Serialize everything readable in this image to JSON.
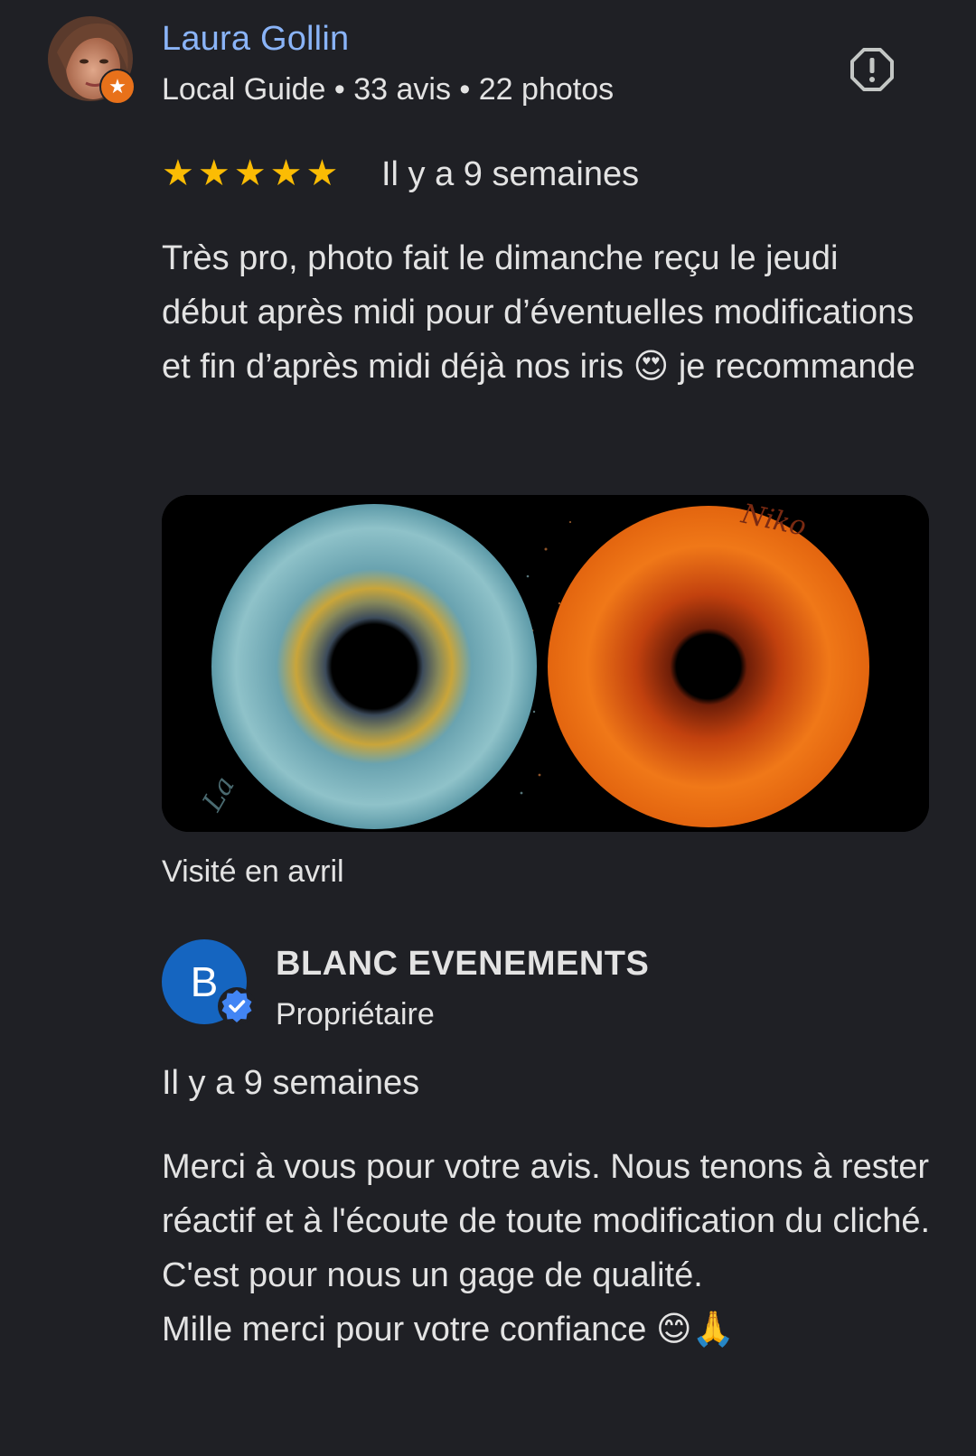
{
  "review": {
    "author": {
      "name": "Laura Gollin",
      "meta": "Local Guide • 33 avis • 22 photos",
      "avatar_icon": "user-photo",
      "badge_icon": "local-guide-star-icon"
    },
    "report_icon": "report-icon",
    "rating": 5,
    "stars": [
      "★",
      "★",
      "★",
      "★",
      "★"
    ],
    "date": "Il y a 9 semaines",
    "text": "Très pro, photo fait le dimanche reçu le jeudi début après midi pour d’éventuelles modifications et fin d’après midi déjà nos iris 😍 je recommande",
    "photo_signatures": [
      "Niko",
      "La"
    ],
    "visited": "Visité en avril"
  },
  "response": {
    "owner_initial": "B",
    "owner_name": "BLANC EVENEMENTS",
    "owner_role": "Propriétaire",
    "verified_icon": "verified-check-icon",
    "date": "Il y a 9 semaines",
    "lines": [
      "Merci à vous pour votre avis. Nous tenons à rester réactif et à l'écoute de toute modification du cliché. C'est pour nous un gage de qualité.",
      "Mille merci pour votre confiance 😊🙏"
    ]
  },
  "colors": {
    "background": "#1f2025",
    "link_blue": "#8ab4f8",
    "star_yellow": "#fbbc04",
    "guide_orange": "#e8711a",
    "owner_blue": "#1565c0"
  }
}
